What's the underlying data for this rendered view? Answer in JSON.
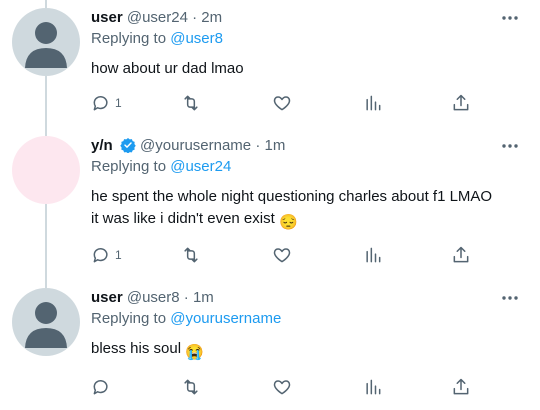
{
  "tweets": [
    {
      "name": "user",
      "handle": "@user24",
      "separator": "·",
      "time": "2m",
      "replying_prefix": "Replying to",
      "replying_to": "@user8",
      "text": "how about ur dad lmao",
      "reply_count": "1",
      "avatar": "default-avatar"
    },
    {
      "name": "y/n",
      "verified": true,
      "handle": "@yourusername",
      "separator": "·",
      "time": "1m",
      "replying_prefix": "Replying to",
      "replying_to": "@user24",
      "text_line1": "he spent the whole night questioning charles about f1 LMAO",
      "text_line2": "it was like i didn't even exist",
      "text_emoji": "😔",
      "reply_count": "1",
      "avatar": "pink-avatar"
    },
    {
      "name": "user",
      "handle": "@user8",
      "separator": "·",
      "time": "1m",
      "replying_prefix": "Replying to",
      "replying_to": "@yourusername",
      "text": "bless his soul",
      "text_emoji": "😭",
      "reply_count": "",
      "avatar": "default-avatar"
    }
  ],
  "colors": {
    "link": "#1d9bf0",
    "secondary_text": "#536471",
    "primary_text": "#0f1419",
    "thread_line": "#cfd9de",
    "avatar_default": "#cfd9de",
    "avatar_pink": "#fde7ef"
  },
  "icons": [
    "more-icon",
    "reply-icon",
    "retweet-icon",
    "like-icon",
    "views-icon",
    "share-icon",
    "verified-icon"
  ]
}
